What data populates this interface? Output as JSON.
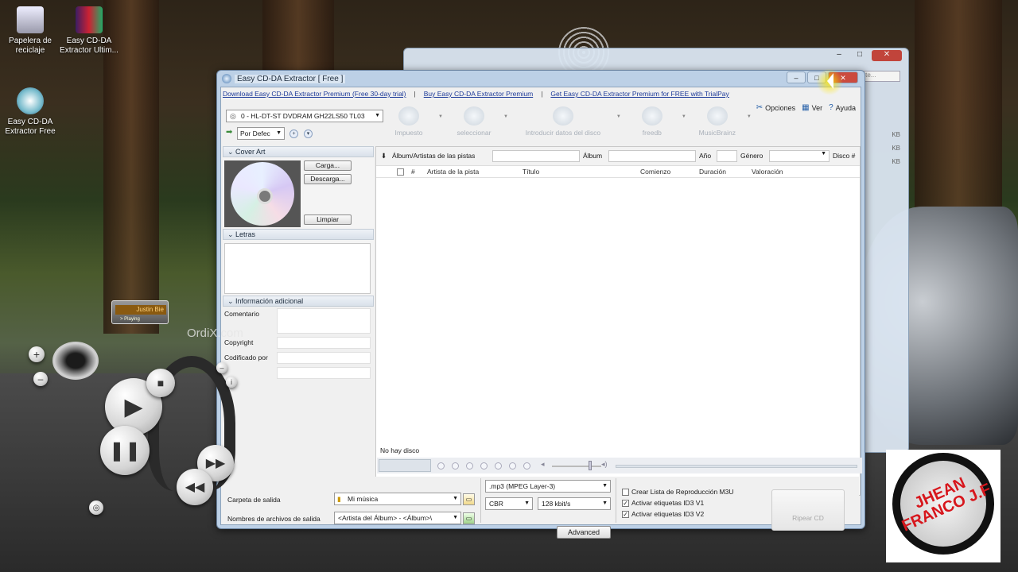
{
  "desktop": {
    "icons": [
      {
        "label": "Papelera de reciclaje",
        "icon": "recycle-bin-icon"
      },
      {
        "label": "Easy CD-DA Extractor Ultim...",
        "icon": "winrar-archive-icon"
      },
      {
        "label": "Easy CD-DA Extractor Free",
        "icon": "cd-extractor-icon"
      }
    ]
  },
  "window": {
    "title": "Easy CD-DA Extractor [ Free ]",
    "links": [
      "Download Easy CD-DA Extractor Premium (Free 30-day trial)",
      "Buy Easy CD-DA Extractor Premium",
      "Get Easy CD-DA Extractor Premium for FREE with TrialPay"
    ],
    "drive": "0 - HL-DT-ST DVDRAM GH22LS50 TL03",
    "profile": "Por Defec",
    "toolbar": [
      "Impuesto",
      "seleccionar",
      "Introducir datos del disco",
      "freedb",
      "MusicBrainz"
    ],
    "menu": [
      "Opciones",
      "Ver",
      "Ayuda"
    ],
    "cover_art": {
      "header": "Cover Art",
      "buttons": [
        "Carga...",
        "Descarga...",
        "Limpiar"
      ]
    },
    "lyrics_header": "Letras",
    "extra": {
      "header": "Información adicional",
      "fields": [
        "Comentario",
        "Copyright",
        "Codificado por"
      ]
    },
    "album_bar": {
      "artist_label": "Álbum/Artistas de las pistas",
      "album_label": "Álbum",
      "year_label": "Año",
      "genre_label": "Género",
      "disc_label": "Disco #"
    },
    "columns": [
      "#",
      "Artista de la pista",
      "Título",
      "Comienzo",
      "Duración",
      "Valoración"
    ],
    "status": "No hay disco",
    "output": {
      "folder_label": "Carpeta de salida",
      "folder_value": "Mi música",
      "names_label": "Nombres de archivos de salida",
      "names_value": "<Artista del Álbum> - <Álbum>\\",
      "format": ".mp3 (MPEG Layer-3)",
      "mode": "CBR",
      "bitrate": "128 kbit/s",
      "advanced": "Advanced"
    },
    "options": [
      {
        "label": "Crear Lista de Reproducción M3U",
        "checked": false
      },
      {
        "label": "Activar etiquetas ID3 V1",
        "checked": true
      },
      {
        "label": "Activar etiquetas ID3 V2",
        "checked": true
      }
    ],
    "rip": "Ripear CD"
  },
  "bg_window": {
    "search_text": "mote...",
    "sizes": [
      "KB",
      "KB",
      "KB"
    ]
  },
  "widgets": {
    "now_playing": "Justin Bie",
    "playing_status": "> Playing",
    "ordix": "OrdiX.com"
  },
  "logo": {
    "text": "JHEAN FRANCO J.F"
  }
}
